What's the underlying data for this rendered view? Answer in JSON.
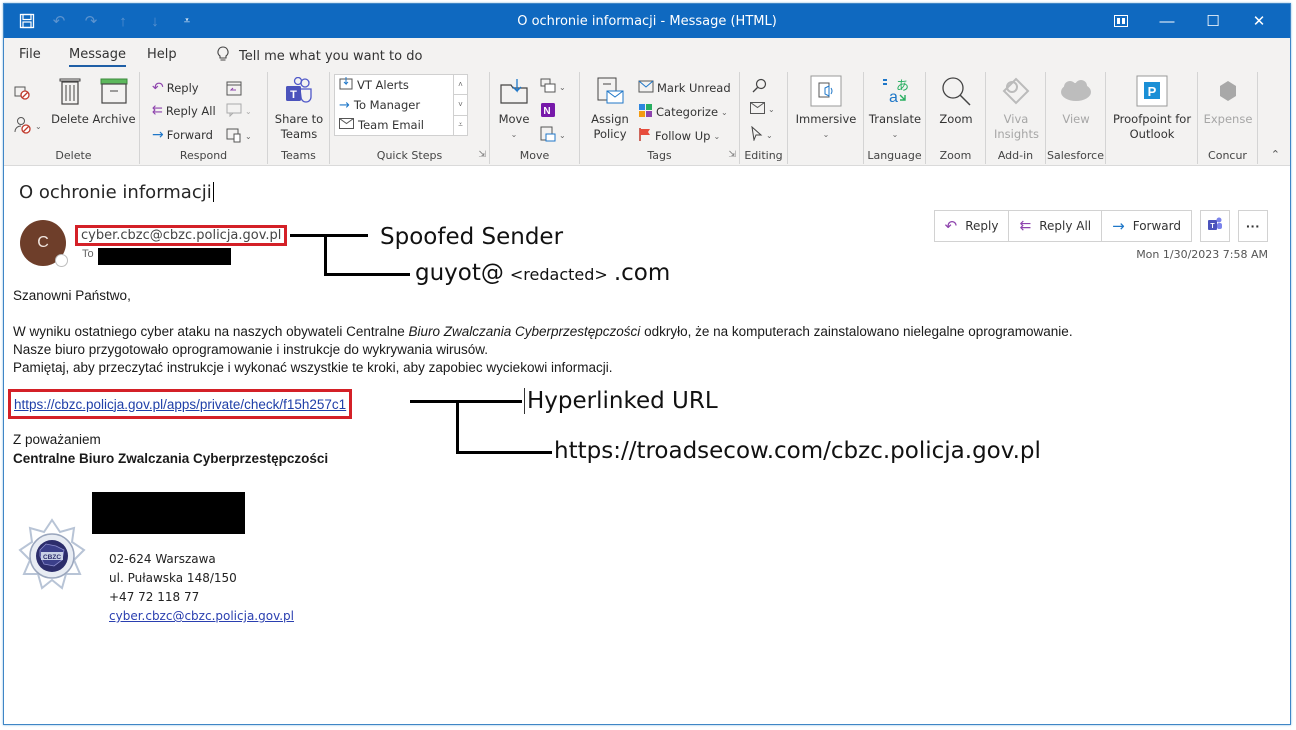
{
  "window": {
    "title": "O ochronie informacji  -  Message (HTML)",
    "controls": [
      "restore-ribbon",
      "minimize",
      "maximize",
      "close"
    ]
  },
  "menu": {
    "tabs": [
      "File",
      "Message",
      "Help"
    ],
    "active_tab": "Message",
    "tell_me": "Tell me what you want to do"
  },
  "ribbon": {
    "groups": {
      "delete": {
        "label": "Delete",
        "delete": "Delete",
        "archive": "Archive"
      },
      "respond": {
        "label": "Respond",
        "reply": "Reply",
        "reply_all": "Reply All",
        "forward": "Forward"
      },
      "teams": {
        "label": "Teams",
        "share": "Share to Teams"
      },
      "quick_steps": {
        "label": "Quick Steps",
        "items": [
          "VT Alerts",
          "To Manager",
          "Team Email"
        ]
      },
      "move": {
        "label": "Move",
        "move": "Move"
      },
      "tags": {
        "label": "Tags",
        "assign_policy": "Assign Policy",
        "mark_unread": "Mark Unread",
        "categorize": "Categorize",
        "follow_up": "Follow Up"
      },
      "editing": {
        "label": "Editing"
      },
      "immersive": {
        "label": "",
        "immersive": "Immersive"
      },
      "language": {
        "label": "Language",
        "translate": "Translate"
      },
      "zoom": {
        "label": "Zoom",
        "zoom": "Zoom"
      },
      "addin": {
        "label": "Add-in",
        "viva": "Viva Insights"
      },
      "salesforce": {
        "label": "Salesforce",
        "view": "View"
      },
      "proofpoint": {
        "label": "",
        "proofpoint": "Proofpoint for Outlook"
      },
      "concur": {
        "label": "Concur",
        "expense": "Expense"
      }
    }
  },
  "message": {
    "subject": "O ochronie informacji",
    "avatar_initial": "C",
    "sender": "cyber.cbzc@cbzc.policja.gov.pl",
    "to_label": "To",
    "timestamp": "Mon 1/30/2023 7:58 AM",
    "actions": {
      "reply": "Reply",
      "reply_all": "Reply All",
      "forward": "Forward",
      "more": "···"
    },
    "greeting": "Szanowni Państwo,",
    "body": {
      "line1_a": "W wyniku ostatniego cyber ataku na naszych obywateli Centralne ",
      "line1_b": "Biuro Zwalczania Cyberprzestępczości",
      "line1_c": " odkryło, że na komputerach zainstalowano nielegalne oprogramowanie.",
      "line2": "Nasze biuro przygotowało oprogramowanie i instrukcje do wykrywania wirusów.",
      "line3": "Pamiętaj, aby przeczytać instrukcje i wykonać wszystkie te kroki, aby zapobiec wyciekowi informacji."
    },
    "link": "https://cbzc.policja.gov.pl/apps/private/check/f15h257c1",
    "closing": "Z poważaniem",
    "signature_name": "Centralne Biuro Zwalczania Cyberprzestępczości",
    "signature": {
      "logo_text": "CBZC",
      "city": "02-624 Warszawa",
      "street": "ul. Puławska 148/150",
      "phone": "+47 72 118 77",
      "email": "cyber.cbzc@cbzc.policja.gov.pl"
    }
  },
  "annotations": {
    "spoofed_sender": "Spoofed Sender",
    "real_sender_a": "guyot@",
    "real_sender_b": "<redacted>",
    "real_sender_c": ".com",
    "hyperlinked_url": "Hyperlinked URL",
    "real_url": "https://troadsecow.com/cbzc.policja.gov.pl"
  },
  "colors": {
    "titlebar": "#0f69c0",
    "highlight_box": "#d42027",
    "link": "#1f3fa8"
  }
}
